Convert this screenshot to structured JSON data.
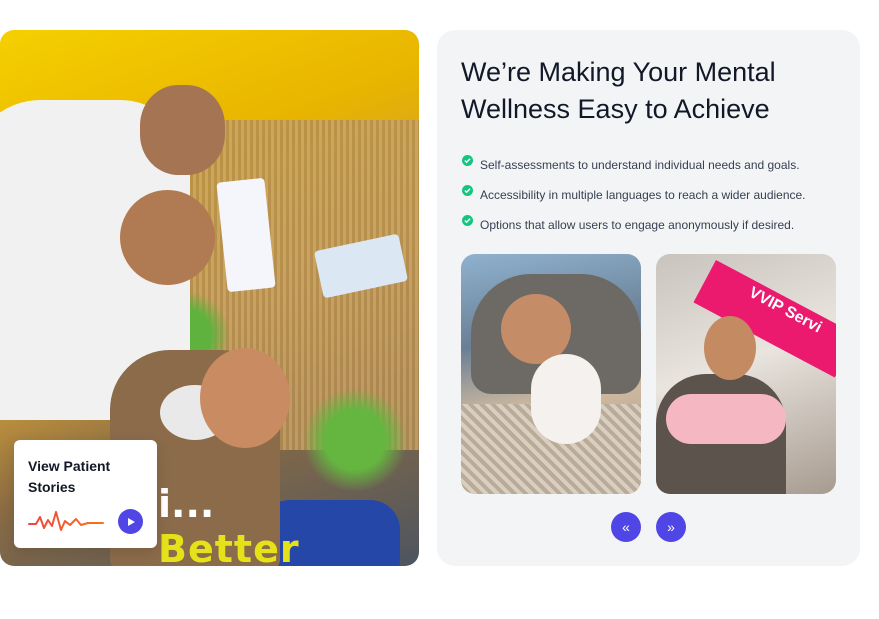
{
  "hero": {
    "image_alt_icon": "photo-icon",
    "overlay_dots": "i...",
    "overlay_word": "Better",
    "overlay_color": "#e6e21a"
  },
  "stories_card": {
    "title": "View Patient Stories",
    "wave_icon": "heartbeat-icon",
    "play_icon": "play-icon"
  },
  "panel": {
    "heading": "We’re Making Your Mental Wellness Easy to Achieve",
    "features": [
      "Self-assessments to understand individual needs and goals.",
      "Accessibility in multiple languages to reach a wider audience.",
      "Options that allow users to engage anonymously if desired."
    ],
    "check_icon": "check-circle-icon",
    "check_color": "#16c47f"
  },
  "carousel": {
    "slides": [
      {
        "icon": "photo-icon"
      },
      {
        "icon": "photo-icon",
        "banner_text": "VVIP Servi"
      }
    ],
    "prev_label": "«",
    "next_label": "»",
    "accent_color": "#4f46e5"
  }
}
